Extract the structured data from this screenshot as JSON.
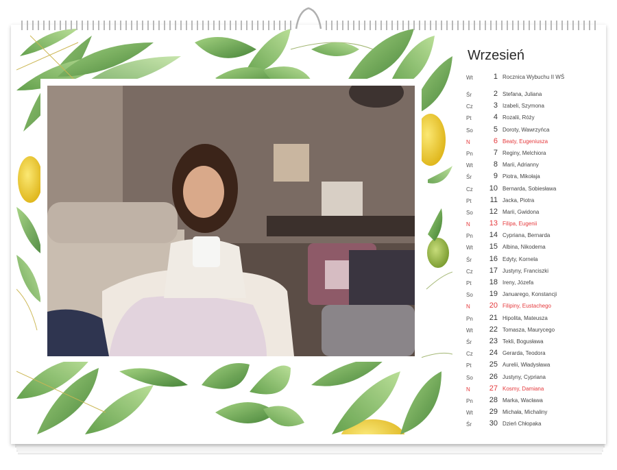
{
  "calendar": {
    "month": "Wrzesień",
    "days": [
      {
        "dow": "Wt",
        "day": "1",
        "name": "Rocznica Wybuchu II WŚ",
        "sunday": false
      },
      {
        "dow": "Śr",
        "day": "2",
        "name": "Stefana, Juliana",
        "sunday": false
      },
      {
        "dow": "Cz",
        "day": "3",
        "name": "Izabeli, Szymona",
        "sunday": false
      },
      {
        "dow": "Pt",
        "day": "4",
        "name": "Rozalii, Róży",
        "sunday": false
      },
      {
        "dow": "So",
        "day": "5",
        "name": "Doroty, Wawrzyńca",
        "sunday": false
      },
      {
        "dow": "N",
        "day": "6",
        "name": "Beaty, Eugeniusza",
        "sunday": true
      },
      {
        "dow": "Pn",
        "day": "7",
        "name": "Reginy, Melchiora",
        "sunday": false
      },
      {
        "dow": "Wt",
        "day": "8",
        "name": "Marii, Adrianny",
        "sunday": false
      },
      {
        "dow": "Śr",
        "day": "9",
        "name": "Piotra, Mikołaja",
        "sunday": false
      },
      {
        "dow": "Cz",
        "day": "10",
        "name": "Bernarda, Sobiesława",
        "sunday": false
      },
      {
        "dow": "Pt",
        "day": "11",
        "name": "Jacka, Piotra",
        "sunday": false
      },
      {
        "dow": "So",
        "day": "12",
        "name": "Marii, Gwidona",
        "sunday": false
      },
      {
        "dow": "N",
        "day": "13",
        "name": "Filipa, Eugenii",
        "sunday": true
      },
      {
        "dow": "Pn",
        "day": "14",
        "name": "Cypriana, Bernarda",
        "sunday": false
      },
      {
        "dow": "Wt",
        "day": "15",
        "name": "Albina, Nikodema",
        "sunday": false
      },
      {
        "dow": "Śr",
        "day": "16",
        "name": "Edyty, Kornela",
        "sunday": false
      },
      {
        "dow": "Cz",
        "day": "17",
        "name": "Justyny, Franciszki",
        "sunday": false
      },
      {
        "dow": "Pt",
        "day": "18",
        "name": "Ireny, Józefa",
        "sunday": false
      },
      {
        "dow": "So",
        "day": "19",
        "name": "Januarego, Konstancji",
        "sunday": false
      },
      {
        "dow": "N",
        "day": "20",
        "name": "Filipiny, Eustachego",
        "sunday": true
      },
      {
        "dow": "Pn",
        "day": "21",
        "name": "Hipolita, Mateusza",
        "sunday": false
      },
      {
        "dow": "Wt",
        "day": "22",
        "name": "Tomasza, Maurycego",
        "sunday": false
      },
      {
        "dow": "Śr",
        "day": "23",
        "name": "Tekli, Bogusława",
        "sunday": false
      },
      {
        "dow": "Cz",
        "day": "24",
        "name": "Gerarda, Teodora",
        "sunday": false
      },
      {
        "dow": "Pt",
        "day": "25",
        "name": "Aurelii, Władysława",
        "sunday": false
      },
      {
        "dow": "So",
        "day": "26",
        "name": "Justyny, Cypriana",
        "sunday": false
      },
      {
        "dow": "N",
        "day": "27",
        "name": "Kosmy, Damiana",
        "sunday": true
      },
      {
        "dow": "Pn",
        "day": "28",
        "name": "Marka, Wacława",
        "sunday": false
      },
      {
        "dow": "Wt",
        "day": "29",
        "name": "Michała, Michaliny",
        "sunday": false
      },
      {
        "dow": "Śr",
        "day": "30",
        "name": "Dzień Chłopaka",
        "sunday": false
      }
    ]
  },
  "colors": {
    "sunday": "#e4393c",
    "leaf_dark": "#4f8f3c",
    "leaf_light": "#8cc46a",
    "lemon": "#f2d23a",
    "spiral": "#b8b8b8"
  },
  "icons": {
    "binding": "spiral-binding-icon",
    "hanger": "hanger-hook-icon"
  }
}
